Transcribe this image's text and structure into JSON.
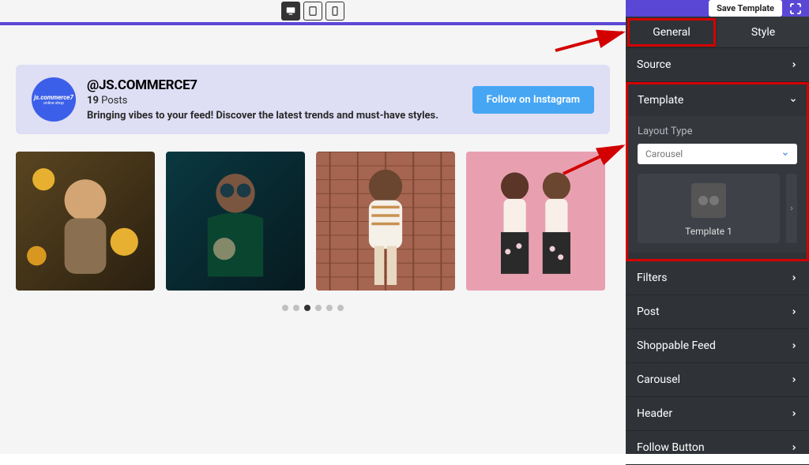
{
  "toolbar": {
    "devices": [
      "desktop",
      "tablet",
      "mobile"
    ]
  },
  "sidebar_header": {
    "save_label": "Save Template"
  },
  "tabs": {
    "general": "General",
    "style": "Style"
  },
  "sidebar": {
    "source": "Source",
    "template": "Template",
    "layout_type_label": "Layout Type",
    "layout_type_value": "Carousel",
    "template_name": "Template 1",
    "filters": "Filters",
    "post": "Post",
    "shoppable_feed": "Shoppable Feed",
    "carousel": "Carousel",
    "header": "Header",
    "follow_button": "Follow Button"
  },
  "card": {
    "avatar_text": "js.commerce7",
    "avatar_sub": "online shop",
    "handle": "@JS.COMMERCE7",
    "post_count": "19",
    "post_suffix": " Posts",
    "bio": "Bringing vibes to your feed! Discover the latest trends and must-have styles.",
    "follow_label": "Follow on Instagram"
  },
  "carousel_dots": 6,
  "active_dot": 2
}
